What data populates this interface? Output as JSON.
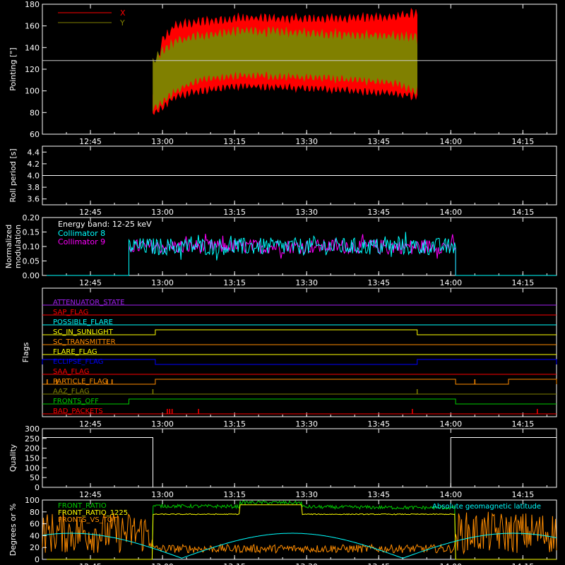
{
  "time_ticks": [
    "12:45",
    "13:00",
    "13:15",
    "13:30",
    "13:45",
    "14:00",
    "14:15"
  ],
  "colors": {
    "background": "#000000",
    "axes": "#ffffff",
    "red": "#ff0000",
    "olive": "#808000",
    "cyan": "#00ffff",
    "magenta": "#ff00ff",
    "yellow": "#ffff00",
    "orange": "#ff8c00",
    "green": "#00cc00",
    "blue": "#0000ff",
    "purple": "#a020f0"
  },
  "chart_data": [
    {
      "type": "area",
      "ylabel": "Pointing [\"]",
      "ylim": [
        60,
        180
      ],
      "yticks": [
        "60",
        "80",
        "100",
        "120",
        "140",
        "160",
        "180"
      ],
      "x_range": [
        "12:35",
        "14:22"
      ],
      "reference_line": 128,
      "legend_placement": "top-left",
      "series": [
        {
          "name": "X",
          "color": "#ff0000",
          "start": "12:58:00",
          "end": "13:53:00",
          "upper": [
            [
              0,
              95
            ],
            [
              2,
              145
            ],
            [
              5,
              160
            ],
            [
              10,
              163
            ],
            [
              20,
              167
            ],
            [
              35,
              166
            ],
            [
              55,
              168
            ],
            [
              60,
              172
            ]
          ],
          "lower": [
            [
              0,
              80
            ],
            [
              2,
              85
            ],
            [
              5,
              95
            ],
            [
              10,
              100
            ],
            [
              20,
              105
            ],
            [
              35,
              103
            ],
            [
              55,
              98
            ],
            [
              60,
              95
            ]
          ]
        },
        {
          "name": "Y",
          "color": "#808000",
          "start": "12:58:00",
          "end": "13:53:00",
          "upper": [
            [
              0,
              125
            ],
            [
              2,
              135
            ],
            [
              5,
              145
            ],
            [
              10,
              150
            ],
            [
              20,
              155
            ],
            [
              35,
              153
            ],
            [
              55,
              150
            ],
            [
              60,
              148
            ]
          ],
          "lower": [
            [
              0,
              85
            ],
            [
              2,
              90
            ],
            [
              5,
              100
            ],
            [
              10,
              110
            ],
            [
              20,
              115
            ],
            [
              35,
              113
            ],
            [
              55,
              108
            ],
            [
              60,
              100
            ]
          ]
        }
      ]
    },
    {
      "type": "line",
      "ylabel": "Roll period [s]",
      "ylim": [
        3.5,
        4.5
      ],
      "yticks": [
        "3.6",
        "3.8",
        "4.0",
        "4.2",
        "4.4"
      ],
      "series": [
        {
          "name": "",
          "value": 4.0,
          "color": "#ffffff"
        }
      ]
    },
    {
      "type": "line",
      "ylabel": "Normalized modulation",
      "ylim": [
        0,
        0.2
      ],
      "yticks": [
        "0.00",
        "0.05",
        "0.10",
        "0.15",
        "0.20"
      ],
      "annotation": "Energy band: 12-25 keV",
      "legend_placement": "top-left",
      "active_start": "12:53:00",
      "active_end": "14:01:00",
      "series": [
        {
          "name": "Collimator 8",
          "color": "#00ffff",
          "mean": 0.1,
          "spread": 0.03
        },
        {
          "name": "Collimator 9",
          "color": "#ff00ff",
          "mean": 0.1,
          "spread": 0.025
        }
      ]
    },
    {
      "type": "line",
      "ylabel": "Flags",
      "series": [
        {
          "name": "ATTENUATOR_STATE",
          "color": "#a020f0",
          "segments": []
        },
        {
          "name": "SAP_FLAG",
          "color": "#ff0000",
          "segments": []
        },
        {
          "name": "POSSIBLE_FLARE",
          "color": "#00ffff",
          "segments": []
        },
        {
          "name": "SC_IN_SUNLIGHT",
          "color": "#ffff00",
          "segments": [
            [
              "12:58:30",
              "13:53:00"
            ]
          ]
        },
        {
          "name": "SC_TRANSMITTER",
          "color": "#ff8c00",
          "segments": []
        },
        {
          "name": "FLARE_FLAG",
          "color": "#ffff00",
          "segments": []
        },
        {
          "name": "ECLIPSE_FLAG",
          "color": "#0000ff",
          "segments": [
            [
              "12:35:00",
              "12:58:30"
            ],
            [
              "13:53:00",
              "14:22:00"
            ]
          ]
        },
        {
          "name": "SAA_FLAG",
          "color": "#ff0000",
          "segments": []
        },
        {
          "name": "PARTICLE_FLAG",
          "color": "#ff8c00",
          "segments": [
            [
              "12:58:30",
              "14:01:00"
            ],
            [
              "14:12:00",
              "14:22:00"
            ]
          ],
          "spikes": [
            "12:36:00",
            "12:38:00",
            "12:48:30",
            "12:49:30",
            "14:05:00"
          ]
        },
        {
          "name": "AAZ_FLAG",
          "color": "#808000",
          "segments": [],
          "spikes": [
            "12:58:00",
            "13:53:00"
          ]
        },
        {
          "name": "FRONTS_OFF",
          "color": "#00cc00",
          "segments": [
            [
              "12:53:00",
              "14:01:00"
            ]
          ]
        },
        {
          "name": "BAD_PACKETS",
          "color": "#ff0000",
          "segments": [],
          "spikes": [
            "13:01:00",
            "13:01:30",
            "13:02:00",
            "13:07:30",
            "13:52:00",
            "14:18:00"
          ]
        }
      ]
    },
    {
      "type": "line",
      "ylabel": "Quality",
      "ylim": [
        0,
        300
      ],
      "yticks": [
        "0",
        "50",
        "100",
        "150",
        "200",
        "250",
        "300"
      ],
      "series": [
        {
          "name": "",
          "color": "#ffffff",
          "high": 255,
          "low": 0,
          "low_start": "12:58:00",
          "low_end": "14:00:00"
        }
      ]
    },
    {
      "type": "line",
      "ylabel": "Degrees or %",
      "ylim": [
        0,
        100
      ],
      "yticks": [
        "0",
        "20",
        "40",
        "60",
        "80",
        "100"
      ],
      "legend_placement": "top-left",
      "series": [
        {
          "name": "FRONT_RATIO",
          "color": "#00cc00"
        },
        {
          "name": "FRONT_RATIO_1225",
          "color": "#ffff00"
        },
        {
          "name": "FRONTS_VS_TOT",
          "color": "#ff8c00"
        },
        {
          "name": "Absolute geomagnetic latitude",
          "color": "#00ffff"
        }
      ]
    }
  ]
}
